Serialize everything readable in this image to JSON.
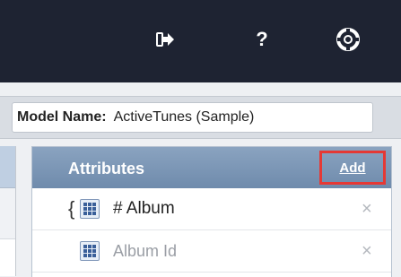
{
  "topbar": {
    "icons": [
      "exit-icon",
      "help-icon",
      "support-lifebuoy-icon"
    ],
    "help_label": "?"
  },
  "model": {
    "label": "Model Name:",
    "value": "ActiveTunes (Sample)"
  },
  "attributes": {
    "title": "Attributes",
    "add_label": "Add",
    "rows": [
      {
        "brace": "{",
        "name": "# Album",
        "delete": "×",
        "icon": "table-grid-icon"
      },
      {
        "name": "Album Id",
        "delete": "×",
        "icon": "table-grid-icon"
      }
    ]
  },
  "colors": {
    "topbar": "#1e2332",
    "header": "#7b95b6",
    "highlight": "#e53935"
  }
}
